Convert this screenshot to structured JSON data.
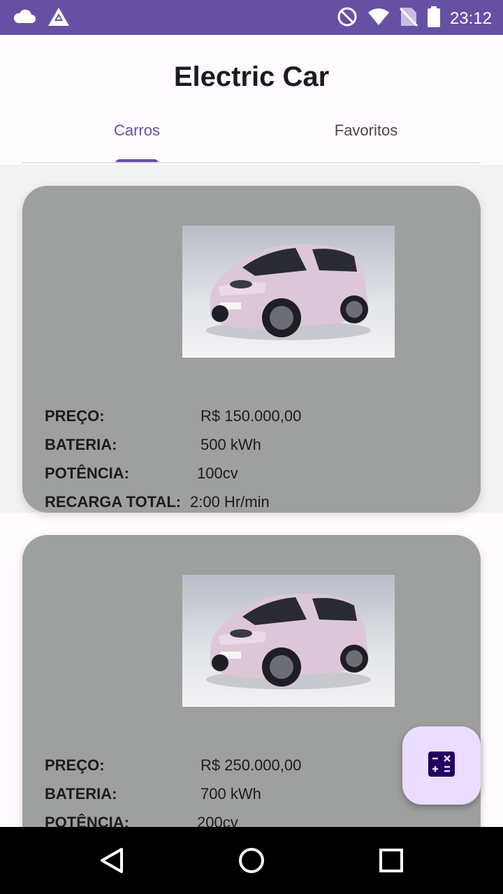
{
  "status_bar": {
    "time": "23:12",
    "left_icons": [
      "cloud-icon",
      "app-logo-icon"
    ],
    "right_icons": [
      "do-not-disturb-icon",
      "wifi-icon",
      "no-sim-icon",
      "battery-icon"
    ],
    "background_color": "#6650A4"
  },
  "app": {
    "title": "Electric Car"
  },
  "tabs": [
    {
      "label": "Carros",
      "selected": true
    },
    {
      "label": "Favoritos",
      "selected": false
    }
  ],
  "cars": [
    {
      "preco_label": "PREÇO:",
      "preco": "R$ 150.000,00",
      "bateria_label": "BATERIA:",
      "bateria": "500 kWh",
      "potencia_label": "POTÊNCIA:",
      "potencia": "100cv",
      "recarga_label": "RECARGA TOTAL:",
      "recarga": "2:00 Hr/min"
    },
    {
      "preco_label": "PREÇO:",
      "preco": "R$ 250.000,00",
      "bateria_label": "BATERIA:",
      "bateria": "700 kWh",
      "potencia_label": "POTÊNCIA:",
      "potencia": "200cv"
    }
  ],
  "fab": {
    "icon": "calculator-icon"
  },
  "nav_bar": {
    "buttons": [
      "back-icon",
      "home-icon",
      "recents-icon"
    ]
  },
  "colors": {
    "accent": "#6650A4",
    "card": "#9EA09F",
    "fab": "#EADDFF"
  }
}
